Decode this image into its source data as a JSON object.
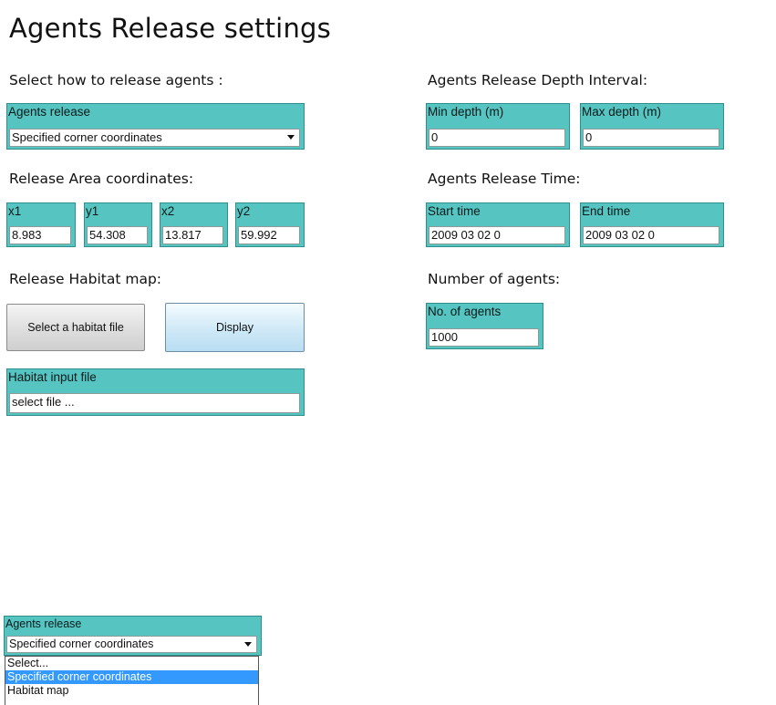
{
  "page": {
    "title": "Agents Release settings"
  },
  "left": {
    "how_label": "Select how to release agents :",
    "release_field": {
      "caption": "Agents release",
      "value": "Specified corner coordinates"
    },
    "area_label": "Release Area coordinates:",
    "coords": [
      {
        "caption": "x1",
        "value": "8.983"
      },
      {
        "caption": "y1",
        "value": "54.308"
      },
      {
        "caption": "x2",
        "value": "13.817"
      },
      {
        "caption": "y2",
        "value": "59.992"
      }
    ],
    "habitat_label": "Release Habitat map:",
    "select_habitat_button": "Select a habitat file",
    "display_button": "Display",
    "habitat_input": {
      "caption": "Habitat input file",
      "value": "select file ..."
    }
  },
  "right": {
    "depth_label": "Agents Release Depth Interval:",
    "min_depth": {
      "caption": "Min depth (m)",
      "value": "0"
    },
    "max_depth": {
      "caption": "Max depth (m)",
      "value": "0"
    },
    "time_label": "Agents Release Time:",
    "start_time": {
      "caption": "Start time",
      "value": "2009 03 02 0"
    },
    "end_time": {
      "caption": "End time",
      "value": "2009 03 02 0"
    },
    "agents_label": "Number of agents:",
    "num_agents": {
      "caption": "No. of agents",
      "value": "1000"
    }
  },
  "dropdown_preview": {
    "caption": "Agents release",
    "value": "Specified corner coordinates",
    "options": [
      "Select...",
      "Specified corner coordinates",
      "Habitat map"
    ],
    "selected_index": 1
  },
  "colors": {
    "field_teal": "#56c5c2",
    "option_highlight": "#3399ff"
  },
  "icons": {
    "dropdown_arrow": "chevron-down-icon"
  }
}
